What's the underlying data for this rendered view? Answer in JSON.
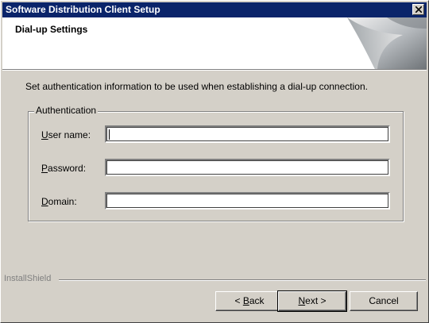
{
  "window": {
    "title": "Software Distribution Client Setup"
  },
  "header": {
    "title": "Dial-up Settings"
  },
  "instruction": "Set authentication information to be used when establishing a dial-up connection.",
  "group": {
    "legend": "Authentication",
    "fields": [
      {
        "label_mnemonic": "U",
        "label_rest": "ser name:",
        "value": ""
      },
      {
        "label_mnemonic": "P",
        "label_rest": "assword:",
        "value": ""
      },
      {
        "label_mnemonic": "D",
        "label_rest": "omain:",
        "value": ""
      }
    ]
  },
  "footer": {
    "brand": "InstallShield",
    "back_prefix": "< ",
    "back_mnemonic": "B",
    "back_rest": "ack",
    "next_mnemonic": "N",
    "next_rest": "ext >",
    "cancel": "Cancel"
  },
  "colors": {
    "titlebar": "#0a246a",
    "face": "#d4d0c8"
  }
}
